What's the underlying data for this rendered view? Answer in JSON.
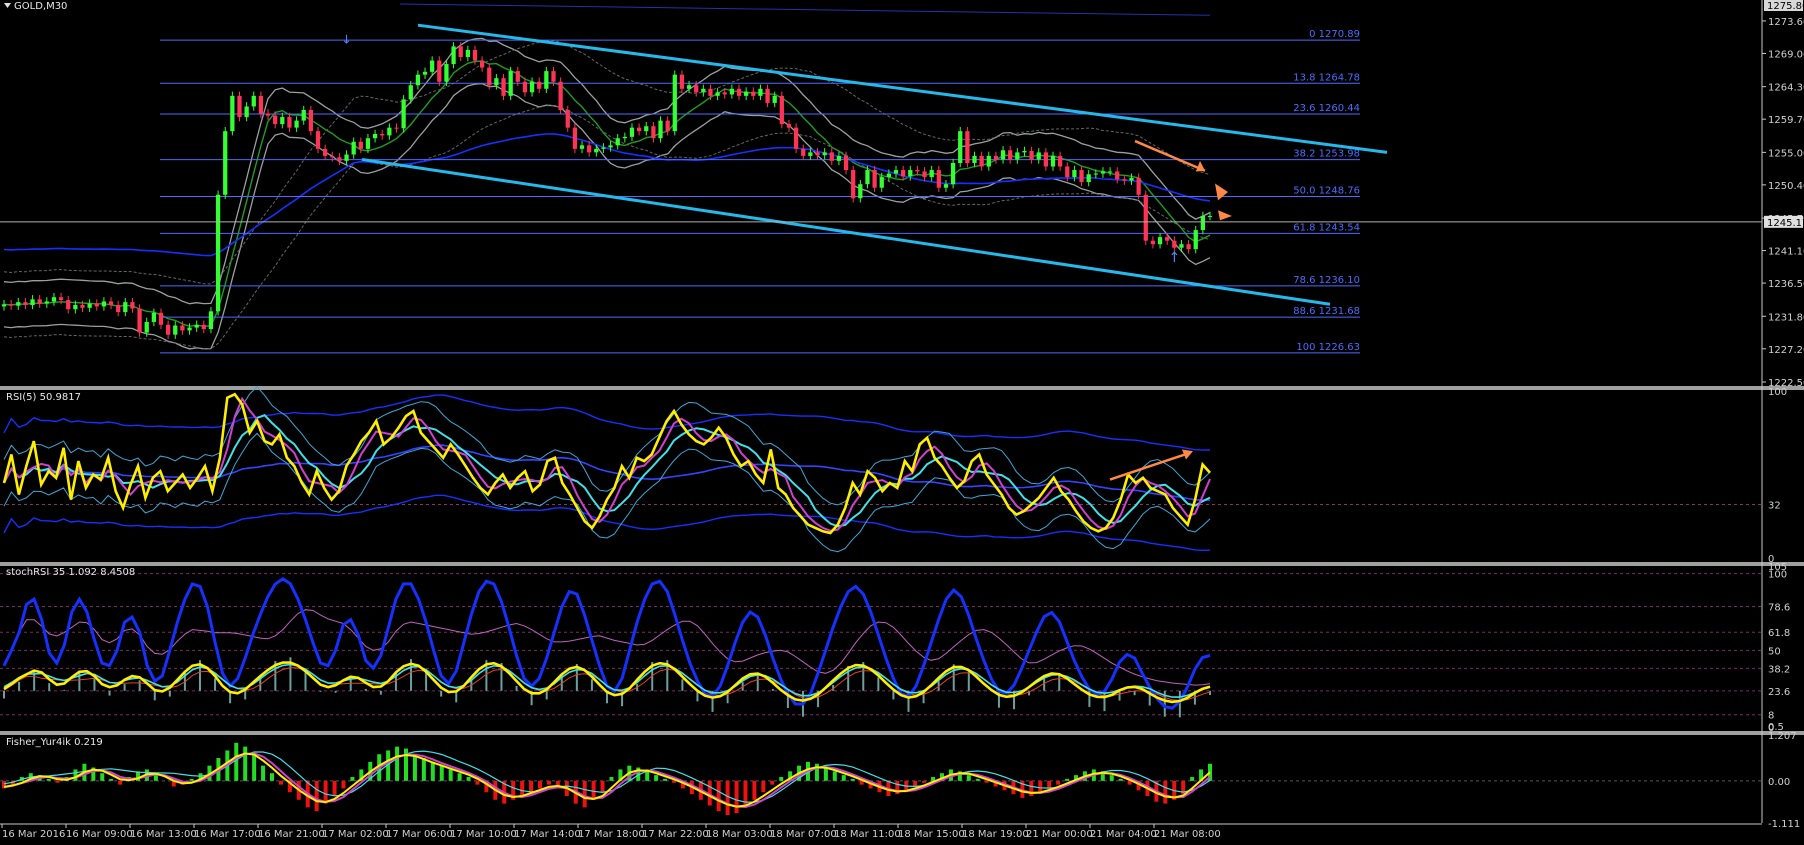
{
  "chart_data": {
    "type": "candlestick",
    "symbol_label": "GOLD,M30",
    "main_panel": {
      "ylim": [
        1222.5,
        1276.0
      ],
      "price_axis_ticks": [
        "1273.60",
        "1269.00",
        "1264.30",
        "1259.70",
        "1255.00",
        "1250.40",
        "1245.70",
        "1241.10",
        "1236.50",
        "1231.80",
        "1227.20",
        "1222.50"
      ],
      "price_axis_values": [
        1273.6,
        1269.0,
        1264.3,
        1259.7,
        1255.0,
        1250.4,
        1245.7,
        1241.1,
        1236.5,
        1231.8,
        1227.2,
        1222.5
      ],
      "top_price_label": "1275.80",
      "current_price_label": "1245.17",
      "current_price": 1245.17,
      "fib_levels": [
        {
          "label": "0 1270.89",
          "price": 1270.89
        },
        {
          "label": "13.8 1264.78",
          "price": 1264.78
        },
        {
          "label": "23.6 1260.44",
          "price": 1260.44
        },
        {
          "label": "38.2 1253.98",
          "price": 1253.98
        },
        {
          "label": "50.0 1248.76",
          "price": 1248.76
        },
        {
          "label": "61.8 1243.54",
          "price": 1243.54
        },
        {
          "label": "78.6 1236.10",
          "price": 1236.1
        },
        {
          "label": "88.6 1231.68",
          "price": 1231.68
        },
        {
          "label": "100 1226.63",
          "price": 1226.63
        }
      ],
      "close_series": [
        1233.5,
        1233.3,
        1233.8,
        1233.4,
        1234.2,
        1233.6,
        1233.9,
        1234.5,
        1234.1,
        1232.8,
        1233.4,
        1233.0,
        1233.6,
        1233.2,
        1233.9,
        1233.4,
        1232.4,
        1233.8,
        1232.9,
        1229.5,
        1231.0,
        1232.3,
        1230.6,
        1229.2,
        1230.5,
        1229.8,
        1230.2,
        1230.6,
        1230.0,
        1232.5,
        1249.0,
        1258.0,
        1263.0,
        1260.0,
        1261.5,
        1263.0,
        1260.5,
        1260.2,
        1259.0,
        1260.0,
        1258.5,
        1259.5,
        1261.0,
        1258.0,
        1255.5,
        1254.5,
        1254.3,
        1253.8,
        1254.7,
        1256.5,
        1255.5,
        1257.0,
        1257.6,
        1257.4,
        1258.5,
        1258.4,
        1262.5,
        1264.5,
        1266.0,
        1266.4,
        1268.0,
        1265.0,
        1267.5,
        1270.0,
        1268.5,
        1269.5,
        1268.0,
        1267.0,
        1264.5,
        1265.5,
        1263.0,
        1266.5,
        1265.0,
        1263.5,
        1265.0,
        1264.0,
        1266.5,
        1265.0,
        1261.0,
        1258.5,
        1255.5,
        1256.0,
        1255.0,
        1255.5,
        1255.7,
        1256.0,
        1257.0,
        1257.2,
        1258.5,
        1258.0,
        1258.7,
        1257.0,
        1259.5,
        1258.0,
        1266.0,
        1264.0,
        1264.5,
        1263.5,
        1264.0,
        1263.0,
        1263.5,
        1263.2,
        1264.0,
        1263.0,
        1263.6,
        1263.0,
        1264.0,
        1262.0,
        1263.0,
        1259.0,
        1258.5,
        1255.5,
        1254.5,
        1255.0,
        1254.6,
        1255.0,
        1253.8,
        1254.5,
        1252.5,
        1248.5,
        1250.5,
        1252.5,
        1250.0,
        1251.5,
        1252.0,
        1252.5,
        1251.6,
        1252.5,
        1252.3,
        1251.5,
        1252.5,
        1250.0,
        1250.5,
        1253.5,
        1258.0,
        1253.5,
        1254.5,
        1253.0,
        1254.5,
        1254.0,
        1255.3,
        1254.0,
        1255.0,
        1255.2,
        1254.0,
        1255.0,
        1253.0,
        1254.5,
        1253.0,
        1251.5,
        1252.5,
        1250.8,
        1251.9,
        1252.0,
        1252.3,
        1252.3,
        1251.2,
        1251.0,
        1251.4,
        1249.0,
        1242.5,
        1242.0,
        1243.0,
        1242.5,
        1241.5,
        1242.0,
        1241.3,
        1244.0,
        1246.0,
        1246.0
      ],
      "channel_upper": {
        "from": [
          1259.0,
          1273.0
        ],
        "to": [
          1364.0,
          1255.0
        ]
      },
      "channel_lower": {
        "from": [
          1262.0,
          1254.0
        ],
        "to": [
          1364.0,
          1233.5
        ]
      },
      "arrows": [
        {
          "type": "blue-up",
          "at_index": 48,
          "price": 1272.0
        },
        {
          "type": "blue-up",
          "at_index": 165,
          "price": 1239.0
        },
        {
          "type": "orange-right-down",
          "price": 1256.0
        }
      ]
    },
    "rsi_panel": {
      "label": "RSI(5) 50.9817",
      "ylim": [
        0,
        100
      ],
      "ticks": [
        "100",
        "32",
        "0"
      ],
      "tick_values": [
        100,
        32,
        0
      ],
      "rsi_series": [
        45,
        62,
        38,
        55,
        70,
        44,
        52,
        48,
        66,
        35,
        58,
        42,
        50,
        47,
        60,
        40,
        30,
        44,
        55,
        36,
        48,
        52,
        40,
        45,
        50,
        42,
        48,
        55,
        40,
        60,
        96,
        98,
        92,
        75,
        82,
        70,
        68,
        74,
        60,
        55,
        45,
        38,
        52,
        42,
        35,
        40,
        55,
        62,
        70,
        75,
        82,
        68,
        72,
        78,
        85,
        88,
        75,
        70,
        65,
        60,
        68,
        62,
        55,
        48,
        42,
        38,
        45,
        50,
        42,
        48,
        52,
        40,
        44,
        58,
        60,
        45,
        38,
        30,
        22,
        18,
        25,
        35,
        42,
        55,
        48,
        60,
        58,
        62,
        72,
        82,
        88,
        80,
        74,
        70,
        68,
        72,
        78,
        72,
        62,
        55,
        58,
        50,
        45,
        65,
        42,
        38,
        30,
        25,
        20,
        18,
        16,
        15,
        20,
        30,
        45,
        38,
        52,
        48,
        40,
        45,
        42,
        58,
        52,
        68,
        72,
        60,
        55,
        48,
        42,
        46,
        58,
        62,
        50,
        44,
        38,
        30,
        26,
        28,
        32,
        36,
        42,
        48,
        40,
        35,
        28,
        22,
        18,
        16,
        18,
        24,
        35,
        50,
        45,
        48,
        42,
        40,
        38,
        30,
        25,
        20,
        35,
        56,
        51
      ],
      "rsi_value": 50.9817
    },
    "stochrsi_panel": {
      "label": "stochRSI 35 1.092 8.4508",
      "ticks": [
        "105",
        "100",
        "78.6",
        "61.8",
        "50",
        "38.2",
        "23.6",
        "8",
        "0.5",
        "0"
      ],
      "tick_values": [
        105,
        100,
        78.6,
        61.8,
        50,
        38.2,
        23.6,
        8,
        0.5,
        0
      ],
      "k_series": [
        40,
        60,
        85,
        95,
        70,
        45,
        30,
        50,
        80,
        95,
        75,
        55,
        40,
        30,
        50,
        70,
        85,
        60,
        40,
        20,
        30,
        50,
        70,
        85,
        95,
        100,
        80,
        55,
        30,
        20,
        30,
        45,
        60,
        75,
        85,
        95,
        100,
        95,
        85,
        70,
        55,
        40,
        30,
        50,
        70,
        80,
        60,
        40,
        30,
        45,
        65,
        85,
        100,
        95,
        85,
        70,
        50,
        30,
        20,
        35,
        55,
        75,
        90,
        100,
        95,
        85,
        65,
        45,
        30,
        20,
        30,
        45,
        60,
        80,
        95,
        90,
        75,
        55,
        40,
        25,
        15,
        30,
        50,
        70,
        85,
        95,
        100,
        90,
        75,
        55,
        40,
        30,
        20,
        15,
        25,
        40,
        55,
        70,
        80,
        75,
        60,
        45,
        30,
        20,
        15,
        10,
        20,
        35,
        50,
        65,
        80,
        90,
        95,
        90,
        75,
        60,
        45,
        30,
        20,
        15,
        25,
        40,
        55,
        70,
        85,
        95,
        88,
        72,
        58,
        42,
        30,
        22,
        18,
        26,
        38,
        50,
        62,
        74,
        80,
        70,
        56,
        42,
        32,
        24,
        18,
        22,
        30,
        42,
        55,
        45,
        35,
        25,
        18,
        12,
        10,
        15,
        25,
        38,
        50,
        48,
        42
      ],
      "value": 8.4508
    },
    "fisher_panel": {
      "label": "Fisher_Yur4ik 0.219",
      "ticks": [
        "1.207",
        "0.00",
        "-1.111"
      ],
      "tick_values": [
        1.207,
        0.0,
        -1.111
      ],
      "histogram": [
        -0.2,
        -0.1,
        0.1,
        0.2,
        0.15,
        0.05,
        -0.05,
        0.1,
        0.3,
        0.45,
        0.35,
        0.2,
        0.05,
        -0.1,
        0.1,
        0.25,
        0.3,
        0.15,
        0.0,
        -0.15,
        -0.1,
        0.05,
        0.2,
        0.4,
        0.6,
        0.8,
        1.0,
        0.9,
        0.7,
        0.4,
        0.2,
        -0.1,
        -0.3,
        -0.5,
        -0.7,
        -0.8,
        -0.6,
        -0.4,
        -0.2,
        0.1,
        0.3,
        0.5,
        0.7,
        0.8,
        0.9,
        0.85,
        0.7,
        0.6,
        0.5,
        0.4,
        0.3,
        0.2,
        0.1,
        -0.1,
        -0.3,
        -0.5,
        -0.6,
        -0.5,
        -0.4,
        -0.3,
        -0.2,
        -0.1,
        -0.2,
        -0.4,
        -0.6,
        -0.7,
        -0.5,
        -0.3,
        0.1,
        0.3,
        0.4,
        0.35,
        0.25,
        0.15,
        0.05,
        -0.05,
        -0.2,
        -0.35,
        -0.5,
        -0.65,
        -0.8,
        -0.9,
        -0.85,
        -0.7,
        -0.5,
        -0.3,
        -0.1,
        0.1,
        0.25,
        0.4,
        0.5,
        0.45,
        0.35,
        0.25,
        0.15,
        0.05,
        -0.1,
        -0.2,
        -0.3,
        -0.4,
        -0.35,
        -0.25,
        -0.15,
        -0.05,
        0.1,
        0.2,
        0.3,
        0.25,
        0.15,
        0.05,
        -0.05,
        -0.15,
        -0.25,
        -0.35,
        -0.45,
        -0.4,
        -0.3,
        -0.2,
        -0.1,
        0.05,
        0.15,
        0.25,
        0.3,
        0.25,
        0.15,
        0.05,
        -0.1,
        -0.25,
        -0.4,
        -0.55,
        -0.6,
        -0.5,
        -0.35,
        0.1,
        0.3,
        0.45
      ],
      "value": 0.219
    },
    "time_axis_labels": [
      "16 Mar 2016",
      "16 Mar 09:00",
      "16 Mar 13:00",
      "16 Mar 17:00",
      "16 Mar 21:00",
      "17 Mar 02:00",
      "17 Mar 06:00",
      "17 Mar 10:00",
      "17 Mar 14:00",
      "17 Mar 18:00",
      "17 Mar 22:00",
      "18 Mar 03:00",
      "18 Mar 07:00",
      "18 Mar 11:00",
      "18 Mar 15:00",
      "18 Mar 19:00",
      "21 Mar 00:00",
      "21 Mar 04:00",
      "21 Mar 08:00"
    ],
    "colors": {
      "background": "#000000",
      "bull_candle": "#33ff33",
      "bear_candle": "#ff3355",
      "fib": "#4b6cff",
      "channel": "#25b8ea",
      "envelope": "#ffffff",
      "ma_green": "#1f9d1f",
      "rsi_yellow": "#ffee00",
      "rsi_cyan": "#40e0e8",
      "rsi_magenta": "#d040d0",
      "band_blue": "#1530ff",
      "orange": "#ff8844"
    }
  }
}
